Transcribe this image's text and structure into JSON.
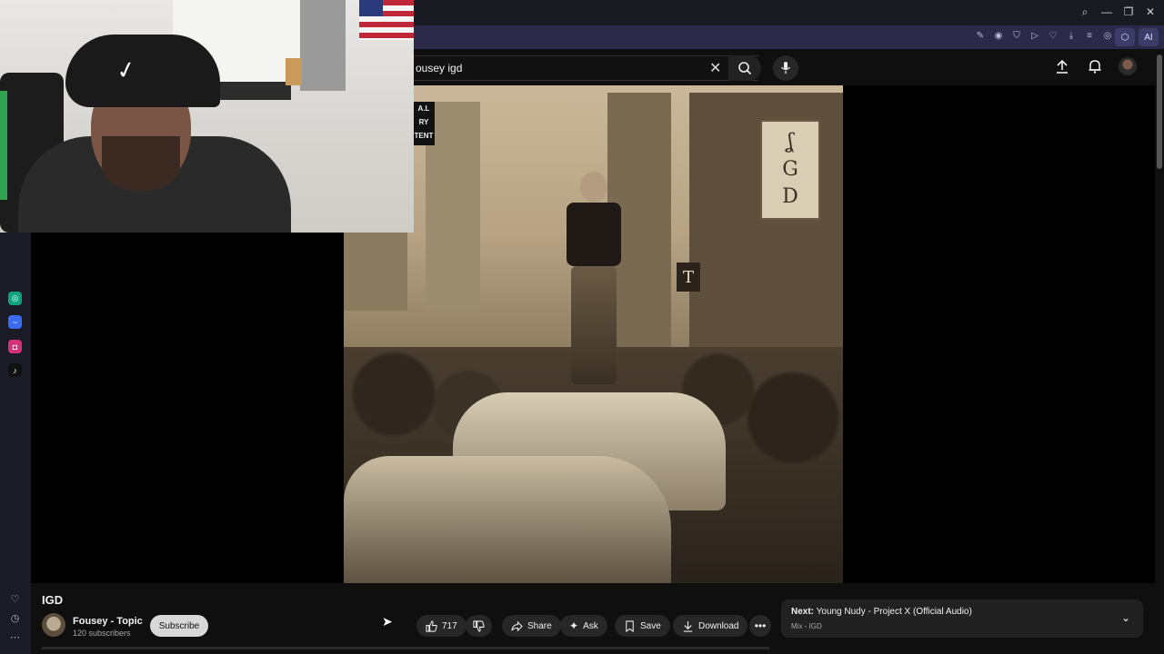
{
  "browser": {
    "window_controls": [
      "search-icon",
      "minimize-icon",
      "restore-icon",
      "close-icon"
    ],
    "toolbar_icons": [
      "edit-icon",
      "camera-icon",
      "shield-icon",
      "play-icon",
      "heart-icon",
      "download-icon",
      "menu-icon",
      "wallet-icon"
    ],
    "ext_buttons": [
      "extension-icon",
      "Aria-icon"
    ],
    "ai_label": "AI",
    "sidebar_icons": [
      "chatgpt-icon",
      "messenger-icon",
      "instagram-icon",
      "tiktok-icon",
      "heart-icon",
      "history-icon",
      "more-icon"
    ]
  },
  "youtube": {
    "search_query": "ousey igd",
    "video_title": "IGD",
    "channel_name": "Fousey - Topic",
    "channel_subs": "120 subscribers",
    "subscribe_label": "Subscribe",
    "like_count": "717",
    "share_label": "Share",
    "ask_label": "Ask",
    "save_label": "Save",
    "download_label": "Download",
    "next_prefix": "Next:",
    "next_title": "Young Nudy - Project X (Official Audio)",
    "next_sub": "Mix - IGD",
    "art_sign": [
      "ʆ",
      "G",
      "D"
    ],
    "art_sign2": "T",
    "art_advisory": [
      "A.L",
      "RY",
      "TENT"
    ]
  },
  "colors": {
    "page_bg": "#0f0f0f",
    "pill_bg": "#272727",
    "browser_toolbar": "#2b2a4a",
    "subscribe_bg": "#d8d8d8"
  }
}
